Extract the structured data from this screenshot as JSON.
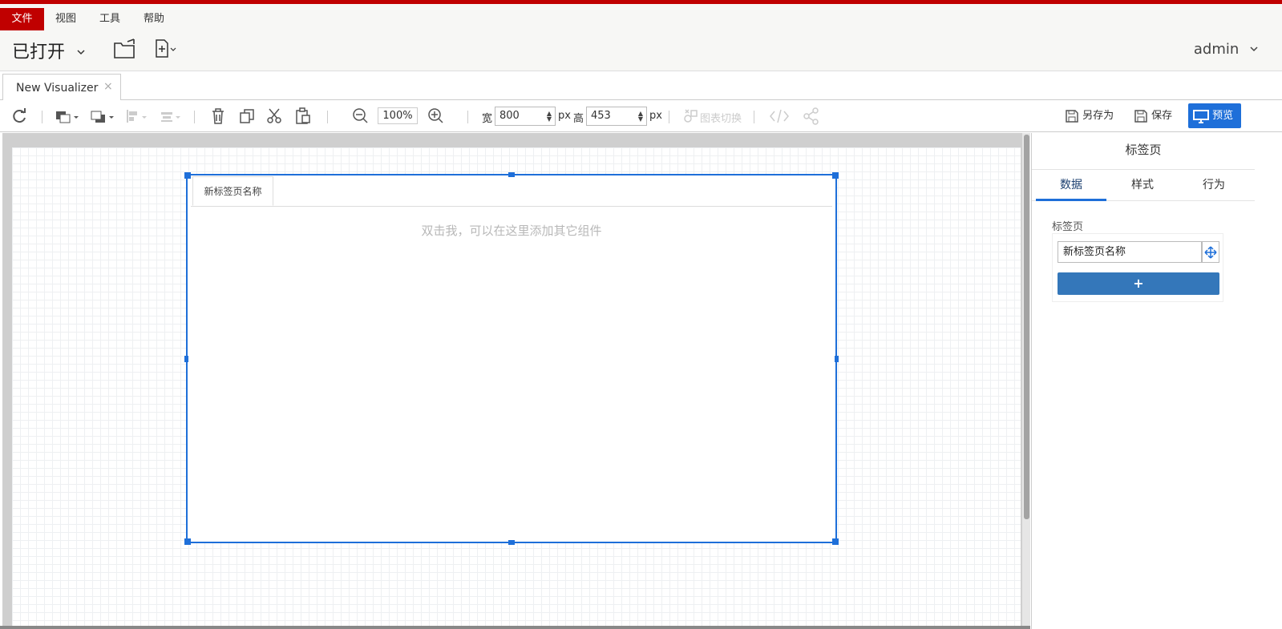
{
  "menu": {
    "items": [
      "文件",
      "视图",
      "工具",
      "帮助"
    ]
  },
  "header": {
    "opened_label": "已打开",
    "user": "admin"
  },
  "doc_tabs": [
    {
      "label": "New Visualizer",
      "close": "×"
    }
  ],
  "toolbar": {
    "zoom": "100%",
    "width_label": "宽",
    "width_value": "800",
    "height_label": "高",
    "height_value": "453",
    "unit": "px",
    "chart_switch": "图表切换",
    "save_as": "另存为",
    "save": "保存",
    "preview": "预览"
  },
  "canvas": {
    "tab_name": "新标签页名称",
    "placeholder": "双击我，可以在这里添加其它组件"
  },
  "panel": {
    "title": "标签页",
    "tabs": [
      "数据",
      "样式",
      "行为"
    ],
    "section": "标签页",
    "tab_name_value": "新标签页名称",
    "add": "+"
  },
  "colors": {
    "brand": "#c00000",
    "accent": "#1e6fd9"
  }
}
